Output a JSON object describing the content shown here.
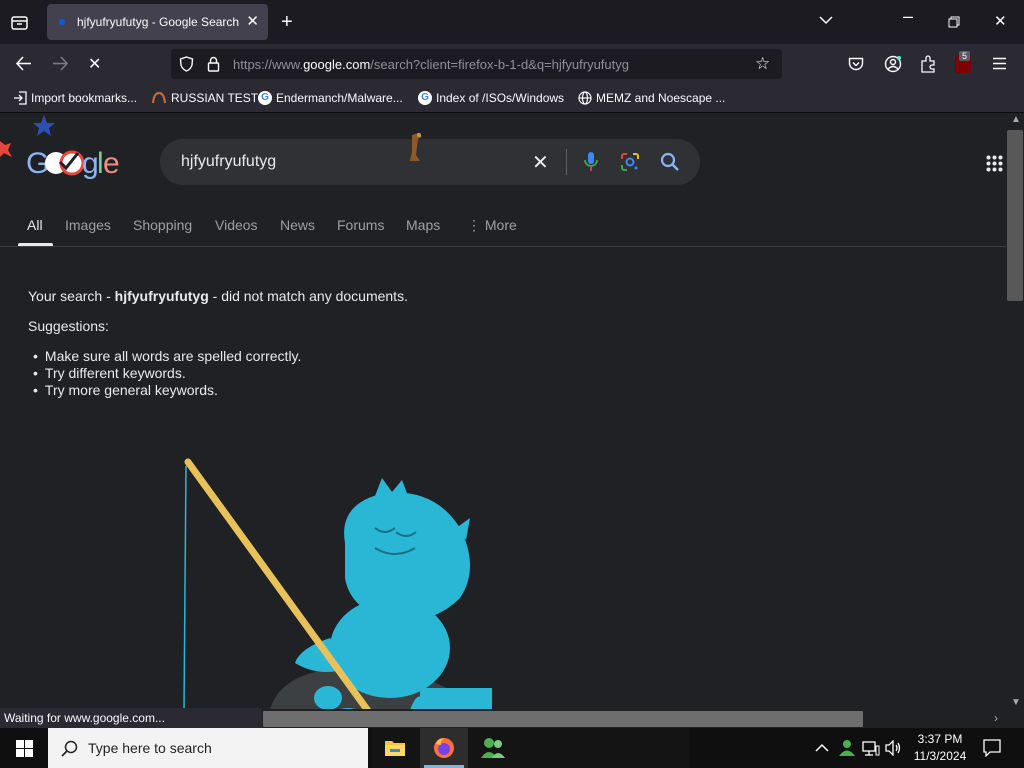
{
  "browser": {
    "tab_title": "hjfyufryufutyg - Google Search",
    "url_prefix": "https://www.",
    "url_domain": "google.com",
    "url_path": "/search?client=firefox-b-1-d&q=hjfyufryufutyg",
    "extension_badge": "5",
    "bookmarks": [
      {
        "label": "Import bookmarks..."
      },
      {
        "label": "RUSSIAN TEST"
      },
      {
        "label": "Endermanch/Malware..."
      },
      {
        "label": "Index of /ISOs/Windows"
      },
      {
        "label": "MEMZ and Noescape ..."
      }
    ],
    "status_text": "Waiting for www.google.com..."
  },
  "google": {
    "query": "hjfyufryufutyg",
    "tabs": [
      "All",
      "Images",
      "Shopping",
      "Videos",
      "News",
      "Forums",
      "Maps",
      "More"
    ],
    "no_results": {
      "prefix": "Your search - ",
      "term": "hjfyufryufutyg",
      "suffix": " - did not match any documents.",
      "suggestions_label": "Suggestions:",
      "suggestions": [
        "Make sure all words are spelled correctly.",
        "Try different keywords.",
        "Try more general keywords."
      ]
    }
  },
  "taskbar": {
    "search_placeholder": "Type here to search",
    "time": "3:37 PM",
    "date": "11/3/2024"
  },
  "colors": {
    "accent": "#8ab4f8",
    "mascot": "#2ab7d6",
    "rod": "#e8c15a"
  }
}
